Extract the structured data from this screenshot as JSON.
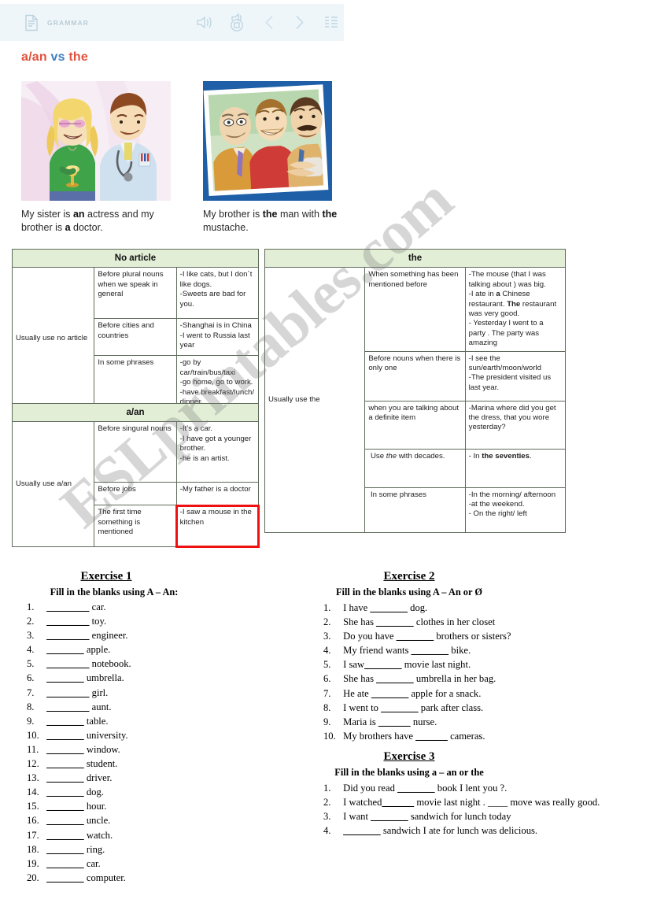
{
  "toolbar": {
    "label": "GRAMMAR",
    "icons": [
      "document-icon",
      "speaker-icon",
      "record-icon",
      "prev-arrow-icon",
      "next-arrow-icon",
      "list-icon"
    ]
  },
  "title": {
    "part1": "a/an",
    "part2": "vs",
    "part3": "the"
  },
  "colors": {
    "accent_red": "#e1523d",
    "accent_blue": "#3b7fc4",
    "table_header_green": "#e3eed7",
    "highlight_red": "#ee1111",
    "toolbar_bg": "#eff6fa"
  },
  "illustrations": [
    {
      "caption_html": "My sister is <b>an</b> actress and my brother is <b>a</b> doctor."
    },
    {
      "caption_html": "My brother is <b>the</b> man with <b>the</b> mustache."
    }
  ],
  "tables": [
    {
      "id": "no-article",
      "header": "No article",
      "lead": "Usually use no article",
      "rows": [
        {
          "case": "Before plural nouns when we speak in general",
          "examples": "-I like cats, but I don´t like dogs.\n-Sweets are bad for you."
        },
        {
          "case": "Before cities and countries",
          "examples": "-Shanghai is in China\n-I went to Russia last year"
        },
        {
          "case": "In some phrases",
          "examples": "-go by car/train/bus/taxi\n-go home, go to work.\n-have breakfast/lunch/ dinner."
        }
      ]
    },
    {
      "id": "a-an",
      "header": "a/an",
      "lead": "Usually use a/an",
      "rows": [
        {
          "case": "Before singural nouns",
          "examples": "-It’s a car.\n-I have got a younger brother.\n-he is an artist."
        },
        {
          "case": "Before jobs",
          "examples": "-My father is a doctor"
        },
        {
          "case": "The first time something is mentioned",
          "examples": "-I saw a mouse in the kitchen",
          "highlighted": true
        }
      ]
    },
    {
      "id": "the",
      "header": "the",
      "lead": "Usually use the",
      "rows": [
        {
          "case": "When something has been mentioned before",
          "examples_html": "-The mouse (that I was talking about ) was big.<br>-I ate in <b>a</b> Chinese restaurant. <b>The</b> restaurant was very good.<br>- Yesterday I went to a party . The party was amazing"
        },
        {
          "case": "Before nouns when there is only one",
          "examples_html": "-I see the sun/earth/moon/world<br>-The president visited us last year."
        },
        {
          "case": "when you are talking about a definite  item",
          "examples_html": "-Marina where did you get the dress, that you wore yesterday?"
        },
        {
          "case_html": "Use <i>the</i> with decades.",
          "examples_html": "- In <b>the seventies</b>."
        },
        {
          "case": "In some phrases",
          "examples_html": "-In the morning/ afternoon<br>-at the weekend.<br>- On the right/ left"
        }
      ]
    }
  ],
  "exercises": [
    {
      "id": "exercise-1",
      "heading": "Exercise 1",
      "instruction": "Fill in the blanks using A – An:",
      "items": [
        {
          "n": "1.",
          "before": "",
          "blank": "________",
          "after": " car."
        },
        {
          "n": "2.",
          "before": "",
          "blank": "________",
          "after": " toy."
        },
        {
          "n": "3.",
          "before": "",
          "blank": "________",
          "after": " engineer."
        },
        {
          "n": "4.",
          "before": "",
          "blank": "_______",
          "after": " apple."
        },
        {
          "n": "5.",
          "before": "",
          "blank": "________",
          "after": " notebook."
        },
        {
          "n": "6.",
          "before": "",
          "blank": "_______",
          "after": " umbrella."
        },
        {
          "n": "7.",
          "before": "",
          "blank": "________",
          "after": " girl."
        },
        {
          "n": "8.",
          "before": "",
          "blank": "________",
          "after": " aunt."
        },
        {
          "n": "9.",
          "before": "",
          "blank": "_______",
          "after": " table."
        },
        {
          "n": "10.",
          "before": "",
          "blank": "_______",
          "after": " university."
        },
        {
          "n": "11.",
          "before": "",
          "blank": "_______",
          "after": " window."
        },
        {
          "n": "12.",
          "before": "",
          "blank": "_______",
          "after": " student."
        },
        {
          "n": "13.",
          "before": "",
          "blank": "_______",
          "after": " driver."
        },
        {
          "n": "14.",
          "before": "",
          "blank": "_______",
          "after": " dog."
        },
        {
          "n": "15.",
          "before": "",
          "blank": "_______",
          "after": " hour."
        },
        {
          "n": "16.",
          "before": "",
          "blank": "_______",
          "after": " uncle."
        },
        {
          "n": "17.",
          "before": "",
          "blank": "_______",
          "after": " watch."
        },
        {
          "n": "18.",
          "before": "",
          "blank": "_______",
          "after": " ring."
        },
        {
          "n": "19.",
          "before": "",
          "blank": "_______",
          "after": " car."
        },
        {
          "n": "20.",
          "before": "",
          "blank": "_______",
          "after": " computer."
        }
      ]
    },
    {
      "id": "exercise-2",
      "heading": "Exercise 2",
      "instruction": "Fill in the blanks using A – An or Ø",
      "items": [
        {
          "n": "1.",
          "before": "I have ",
          "blank": "_______",
          "after": " dog."
        },
        {
          "n": "2.",
          "before": "She has ",
          "blank": "_______",
          "after": " clothes in her closet"
        },
        {
          "n": "3.",
          "before": "Do you have ",
          "blank": "_______",
          "after": " brothers or sisters?"
        },
        {
          "n": "4.",
          "before": "My friend wants ",
          "blank": "_______",
          "after": " bike."
        },
        {
          "n": "5.",
          "before": "I saw",
          "blank": "_______",
          "after": " movie last night."
        },
        {
          "n": "6.",
          "before": "She has ",
          "blank": "_______",
          "after": " umbrella in her bag."
        },
        {
          "n": "7.",
          "before": "He ate ",
          "blank": "_______",
          "after": " apple for a snack."
        },
        {
          "n": "8.",
          "before": "I went to ",
          "blank": "_______",
          "after": " park after class."
        },
        {
          "n": "9.",
          "before": "Maria is ",
          "blank": "______",
          "after": " nurse."
        },
        {
          "n": "10.",
          "before": "My brothers have ",
          "blank": "______",
          "after": " cameras."
        }
      ]
    },
    {
      "id": "exercise-3",
      "heading": "Exercise 3",
      "instruction": "Fill in the blanks using a – an or the",
      "items": [
        {
          "n": "1.",
          "before": "Did you read ",
          "blank": "_______",
          "after": " book I lent you ?."
        },
        {
          "n": "2.",
          "before": "I watched",
          "blank": "______",
          "after": " movie last night . ____ move was really good."
        },
        {
          "n": "3.",
          "before": "I want ",
          "blank": "_______",
          "after": " sandwich for lunch today"
        },
        {
          "n": "4.",
          "before": "",
          "blank": "_______",
          "after": " sandwich I ate for lunch was delicious."
        }
      ]
    }
  ],
  "watermark": {
    "text": "ESLprintables.com"
  }
}
